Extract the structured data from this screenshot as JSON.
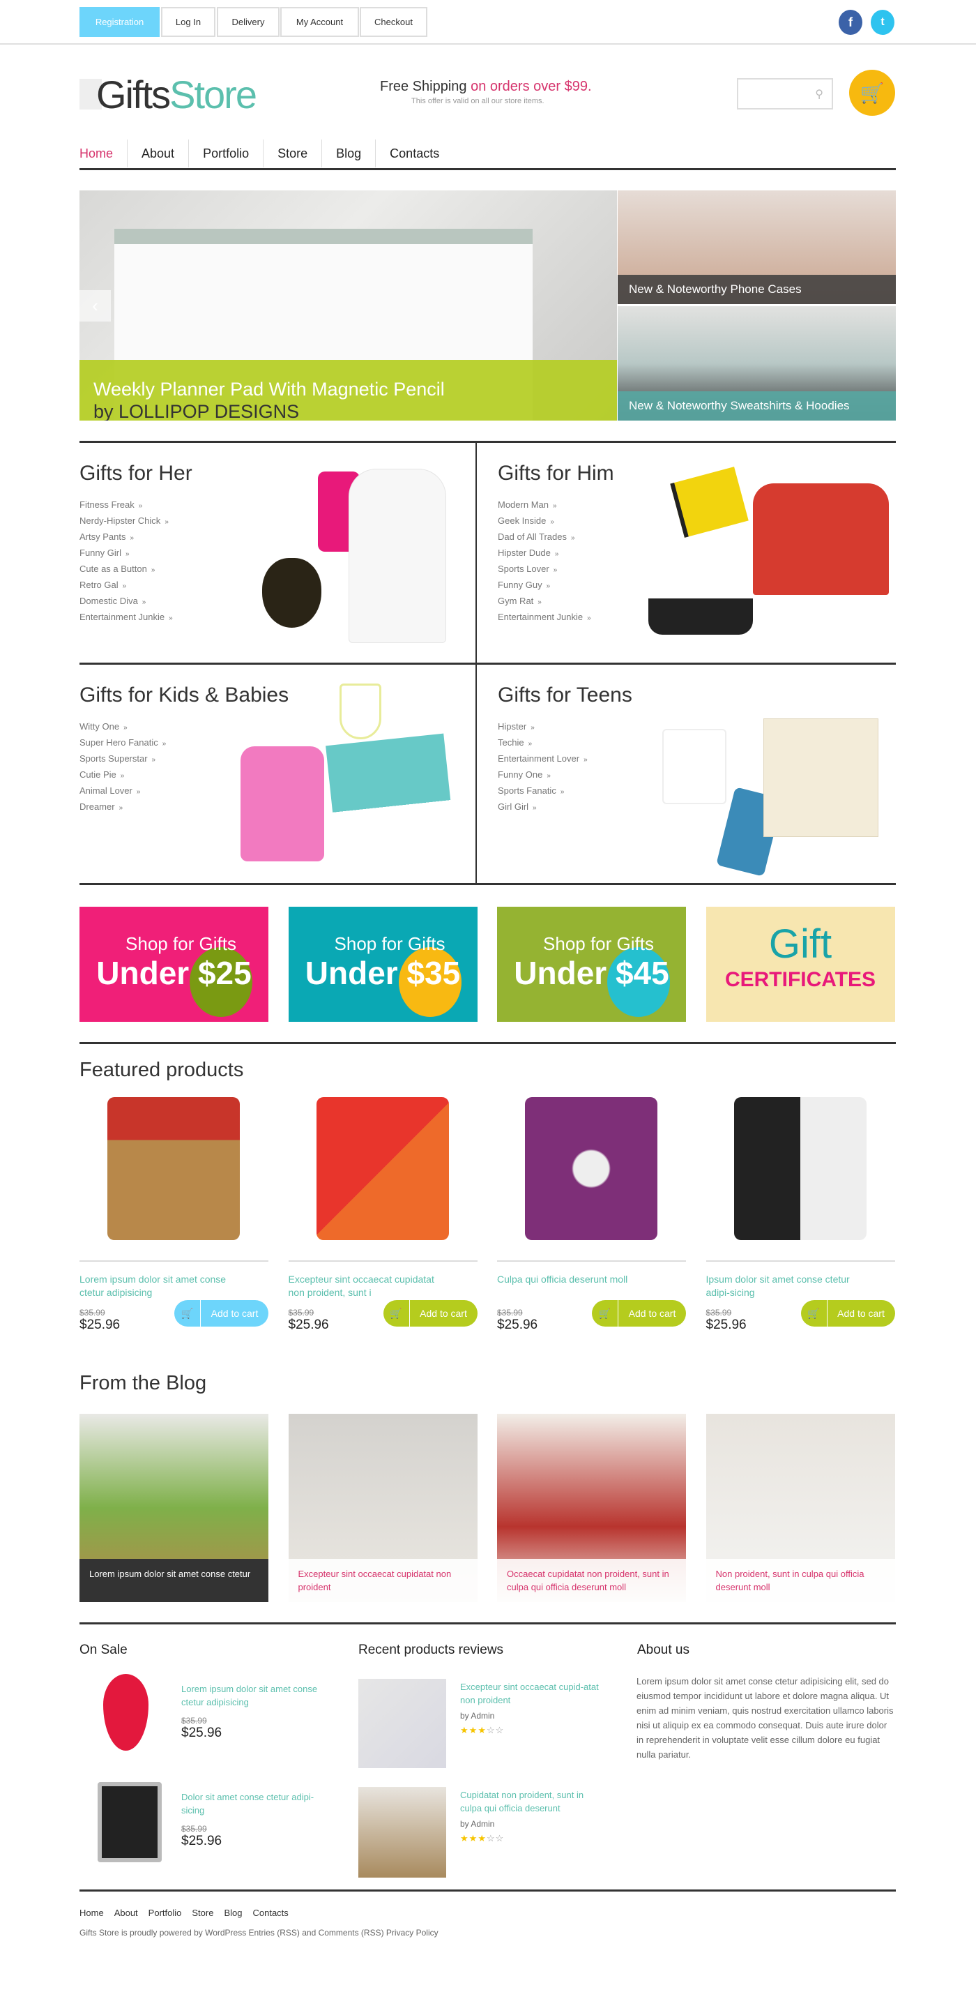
{
  "topbar": {
    "links": [
      "Registration",
      "Log In",
      "Delivery",
      "My Account",
      "Checkout"
    ],
    "social": [
      "facebook-icon",
      "twitter-icon"
    ]
  },
  "header": {
    "logo_a": "Gifts",
    "logo_b": "Store",
    "shipping_a": "Free Shipping",
    "shipping_b": "on orders over $99.",
    "shipping_note": "This offer is valid on all our store items.",
    "search_placeholder": ""
  },
  "nav": [
    "Home",
    "About",
    "Portfolio",
    "Store",
    "Blog",
    "Contacts"
  ],
  "hero": {
    "title": "Weekly Planner Pad With Magnetic Pencil",
    "subtitle": "by LOLLIPOP DESIGNS",
    "side": [
      "New & Noteworthy Phone Cases",
      "New & Noteworthy Sweatshirts & Hoodies"
    ]
  },
  "categories": [
    {
      "title": "Gifts for Her",
      "items": [
        "Fitness Freak",
        "Nerdy-Hipster Chick",
        "Artsy Pants",
        "Funny Girl",
        "Cute as a Button",
        "Retro Gal",
        "Domestic Diva",
        "Entertainment Junkie"
      ]
    },
    {
      "title": "Gifts for Him",
      "items": [
        "Modern Man",
        "Geek Inside",
        "Dad of All Trades",
        "Hipster Dude",
        "Sports Lover",
        "Funny Guy",
        "Gym Rat",
        "Entertainment Junkie"
      ]
    },
    {
      "title": "Gifts for Kids & Babies",
      "items": [
        "Witty One",
        "Super Hero Fanatic",
        "Sports Superstar",
        "Cutie Pie",
        "Animal Lover",
        "Dreamer"
      ]
    },
    {
      "title": "Gifts for Teens",
      "items": [
        "Hipster",
        "Techie",
        "Entertainment Lover",
        "Funny One",
        "Sports Fanatic",
        "Girl Girl"
      ]
    }
  ],
  "chevron": "»",
  "promos": [
    {
      "line1": "Shop for Gifts",
      "under": "Under",
      "amount": "$25",
      "bg": "#f01f78",
      "circle": "#7a9a12"
    },
    {
      "line1": "Shop for Gifts",
      "under": "Under",
      "amount": "$35",
      "bg": "#0aa8b4",
      "circle": "#f8b912"
    },
    {
      "line1": "Shop for Gifts",
      "under": "Under",
      "amount": "$45",
      "bg": "#95b332",
      "circle": "#25c0cf"
    },
    {
      "line1": "Gift",
      "under": "CERTIFICATES",
      "bg": "#f7e6b0"
    }
  ],
  "featured": {
    "title": "Featured products",
    "add_label": "Add to cart",
    "products": [
      {
        "title": "Lorem ipsum dolor sit amet conse ctetur adipisicing",
        "old": "$35.99",
        "price": "$25.96",
        "btn": "#6dd5fb"
      },
      {
        "title": "Excepteur sint occaecat cupidatat non proident, sunt i",
        "old": "$35.99",
        "price": "$25.96",
        "btn": "#b5cc1e"
      },
      {
        "title": "Culpa qui officia deserunt moll",
        "old": "$35.99",
        "price": "$25.96",
        "btn": "#b5cc1e"
      },
      {
        "title": "Ipsum dolor sit amet conse ctetur adipi-sicing",
        "old": "$35.99",
        "price": "$25.96",
        "btn": "#b5cc1e"
      }
    ]
  },
  "blog": {
    "title": "From the Blog",
    "posts": [
      "Lorem ipsum dolor sit amet conse ctetur",
      "Excepteur sint occaecat cupidatat non proident",
      "Occaecat cupidatat non proident, sunt in culpa qui officia deserunt moll",
      "Non proident, sunt in culpa qui officia deserunt moll"
    ]
  },
  "on_sale": {
    "title": "On Sale",
    "items": [
      {
        "title": "Lorem ipsum dolor sit amet conse ctetur adipisicing",
        "old": "$35.99",
        "price": "$25.96"
      },
      {
        "title": "Dolor sit amet conse ctetur adipi-sicing",
        "old": "$35.99",
        "price": "$25.96"
      }
    ]
  },
  "reviews": {
    "title": "Recent products reviews",
    "items": [
      {
        "title": "Excepteur sint occaecat cupid-atat non proident",
        "by": "by Admin",
        "rating": 2.5
      },
      {
        "title": "Cupidatat non proident, sunt in culpa qui officia deserunt",
        "by": "by Admin",
        "rating": 2.5
      }
    ]
  },
  "about": {
    "title": "About us",
    "text": "Lorem ipsum dolor sit amet conse ctetur adipisicing elit, sed do eiusmod tempor incididunt ut labore et dolore magna aliqua. Ut enim ad minim veniam, quis nostrud exercitation ullamco laboris nisi ut aliquip ex ea commodo consequat. Duis aute irure dolor in reprehenderit in voluptate velit esse cillum dolore eu fugiat nulla pariatur."
  },
  "footer": {
    "links": [
      "Home",
      "About",
      "Portfolio",
      "Store",
      "Blog",
      "Contacts"
    ],
    "copyright": "Gifts Store is proudly powered by WordPress Entries (RSS) and Comments (RSS) Privacy Policy"
  },
  "colors": {
    "accent_pink": "#d6336c",
    "accent_teal": "#5bbfad",
    "cart": "#f7b90f",
    "registration": "#6dd5fb"
  }
}
